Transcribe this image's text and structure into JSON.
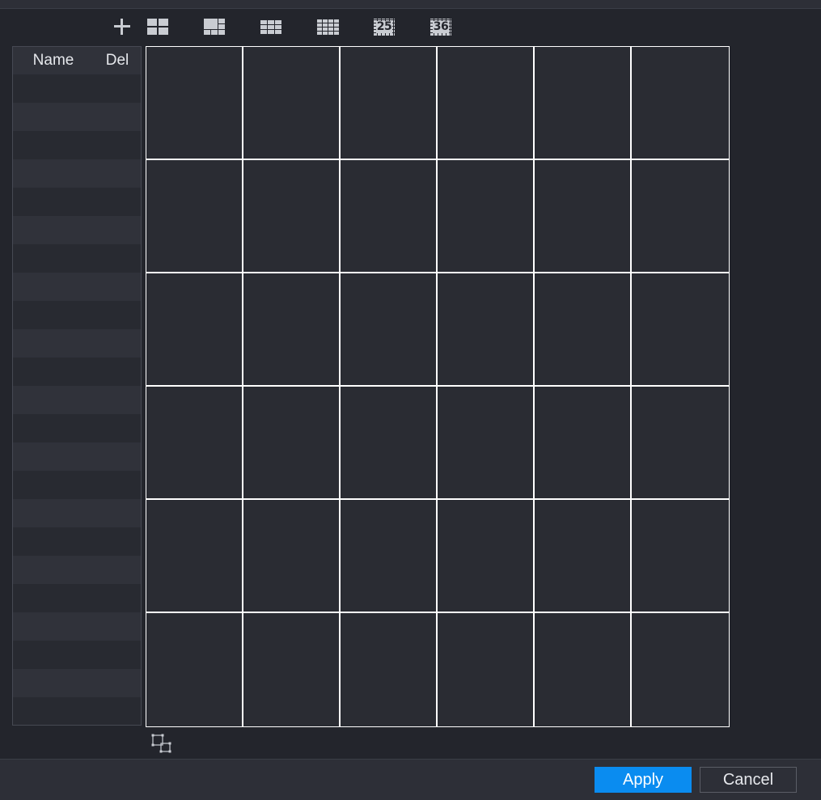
{
  "toolbar": {
    "layouts": [
      {
        "icon": "add-icon"
      },
      {
        "icon": "layout-4-icon"
      },
      {
        "icon": "layout-6-icon"
      },
      {
        "icon": "layout-9-icon"
      },
      {
        "icon": "layout-16-icon"
      },
      {
        "icon": "layout-25-icon",
        "label": "25"
      },
      {
        "icon": "layout-36-icon",
        "label": "36"
      }
    ]
  },
  "list": {
    "col_name": "Name",
    "col_del": "Del",
    "rows": []
  },
  "grid": {
    "rows": 6,
    "cols": 6
  },
  "footer": {
    "apply_label": "Apply",
    "cancel_label": "Cancel"
  },
  "colors": {
    "background": "#23252c",
    "accent": "#0a8cf0",
    "grid_line": "#ffffff"
  }
}
